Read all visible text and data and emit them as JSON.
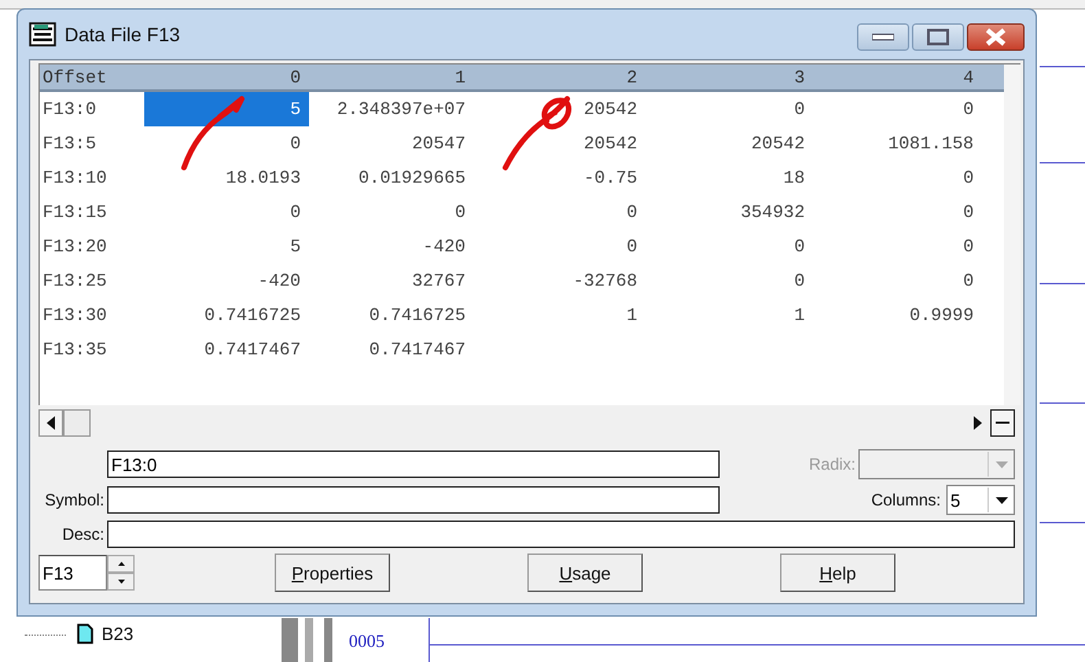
{
  "window": {
    "title": "Data File F13"
  },
  "table": {
    "columns": [
      "Offset",
      "0",
      "1",
      "2",
      "3",
      "4"
    ],
    "rows": [
      {
        "cells": [
          {
            "text": "F13:0",
            "selected": false
          },
          {
            "text": "5",
            "selected": true
          },
          {
            "text": "2.348397e+07",
            "selected": false
          },
          {
            "text": "20542",
            "selected": false
          },
          {
            "text": "0",
            "selected": false
          },
          {
            "text": "0",
            "selected": false
          }
        ]
      },
      {
        "cells": [
          {
            "text": "F13:5",
            "selected": false
          },
          {
            "text": "0",
            "selected": false
          },
          {
            "text": "20547",
            "selected": false
          },
          {
            "text": "20542",
            "selected": false
          },
          {
            "text": "20542",
            "selected": false
          },
          {
            "text": "1081.158",
            "selected": false
          }
        ]
      },
      {
        "cells": [
          {
            "text": "F13:10",
            "selected": false
          },
          {
            "text": "18.0193",
            "selected": false
          },
          {
            "text": "0.01929665",
            "selected": false
          },
          {
            "text": "-0.75",
            "selected": false
          },
          {
            "text": "18",
            "selected": false
          },
          {
            "text": "0",
            "selected": false
          }
        ]
      },
      {
        "cells": [
          {
            "text": "F13:15",
            "selected": false
          },
          {
            "text": "0",
            "selected": false
          },
          {
            "text": "0",
            "selected": false
          },
          {
            "text": "0",
            "selected": false
          },
          {
            "text": "354932",
            "selected": false
          },
          {
            "text": "0",
            "selected": false
          }
        ]
      },
      {
        "cells": [
          {
            "text": "F13:20",
            "selected": false
          },
          {
            "text": "5",
            "selected": false
          },
          {
            "text": "-420",
            "selected": false
          },
          {
            "text": "0",
            "selected": false
          },
          {
            "text": "0",
            "selected": false
          },
          {
            "text": "0",
            "selected": false
          }
        ]
      },
      {
        "cells": [
          {
            "text": "F13:25",
            "selected": false
          },
          {
            "text": "-420",
            "selected": false
          },
          {
            "text": "32767",
            "selected": false
          },
          {
            "text": "-32768",
            "selected": false
          },
          {
            "text": "0",
            "selected": false
          },
          {
            "text": "0",
            "selected": false
          }
        ]
      },
      {
        "cells": [
          {
            "text": "F13:30",
            "selected": false
          },
          {
            "text": "0.7416725",
            "selected": false
          },
          {
            "text": "0.7416725",
            "selected": false
          },
          {
            "text": "1",
            "selected": false
          },
          {
            "text": "1",
            "selected": false
          },
          {
            "text": "0.9999",
            "selected": false
          }
        ]
      },
      {
        "cells": [
          {
            "text": "F13:35",
            "selected": false
          },
          {
            "text": "0.7417467",
            "selected": false
          },
          {
            "text": "0.7417467",
            "selected": false
          }
        ]
      }
    ]
  },
  "address": {
    "value": "F13:0"
  },
  "radix": {
    "label": "Radix:",
    "disabled": true
  },
  "symbol": {
    "label": "Symbol:"
  },
  "columns": {
    "label": "Columns:",
    "value": "5"
  },
  "desc": {
    "label": "Desc:"
  },
  "file": {
    "value": "F13"
  },
  "buttons": [
    {
      "label": "Properties",
      "underline_first": true
    },
    {
      "label": "Usage",
      "underline_first": true
    },
    {
      "label": "Help",
      "underline_first": true
    }
  ],
  "background": {
    "tree_item": "B23",
    "rung_number": "0005"
  }
}
